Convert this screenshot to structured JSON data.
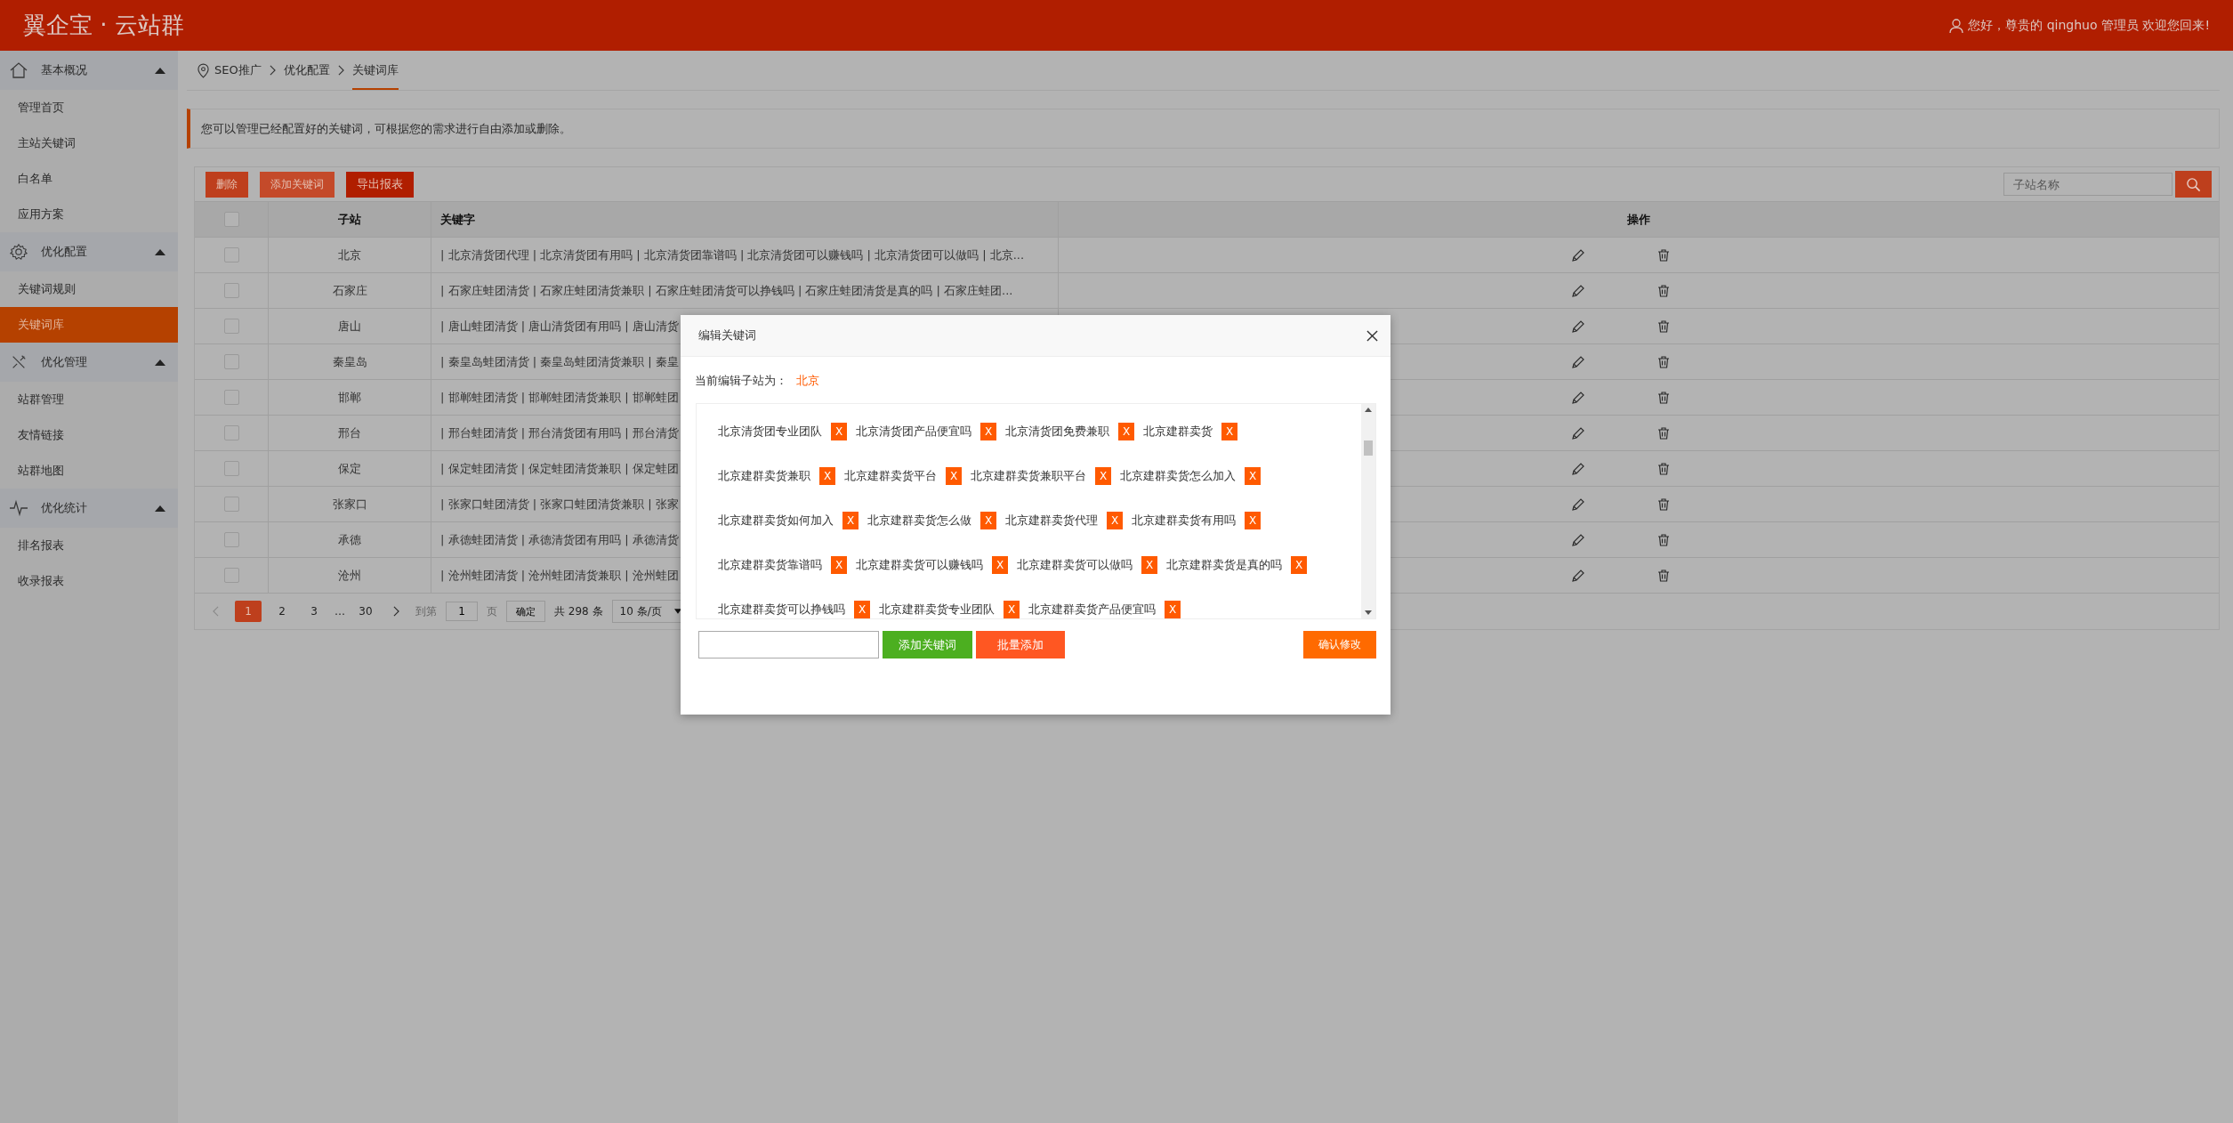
{
  "header": {
    "title": "翼企宝 · 云站群",
    "greeting": "您好，尊贵的 qinghuo 管理员 欢迎您回来!"
  },
  "sidebar": {
    "groups": [
      {
        "label": "基本概况",
        "expanded": true,
        "items": [
          {
            "label": "管理首页",
            "selected": false
          },
          {
            "label": "主站关键词",
            "selected": false
          },
          {
            "label": "白名单",
            "selected": false
          },
          {
            "label": "应用方案",
            "selected": false
          }
        ]
      },
      {
        "label": "优化配置",
        "expanded": true,
        "items": [
          {
            "label": "关键词规则",
            "selected": false
          },
          {
            "label": "关键词库",
            "selected": true
          }
        ]
      },
      {
        "label": "优化管理",
        "expanded": true,
        "items": [
          {
            "label": "站群管理",
            "selected": false
          },
          {
            "label": "友情链接",
            "selected": false
          },
          {
            "label": "站群地图",
            "selected": false
          }
        ]
      },
      {
        "label": "优化统计",
        "expanded": true,
        "items": [
          {
            "label": "排名报表",
            "selected": false
          },
          {
            "label": "收录报表",
            "selected": false
          }
        ]
      }
    ]
  },
  "breadcrumb": [
    {
      "label": "SEO推广",
      "selected": false
    },
    {
      "label": "优化配置",
      "selected": false
    },
    {
      "label": "关键词库",
      "selected": true
    }
  ],
  "notice": "您可以管理已经配置好的关键词，可根据您的需求进行自由添加或删除。",
  "toolbar": {
    "buttons": [
      "删除",
      "添加关键词",
      "导出报表"
    ],
    "search": {
      "placeholder": "子站名称"
    }
  },
  "table": {
    "select_all_checked": false,
    "columns": [
      "子站",
      "关键字",
      "操作"
    ],
    "rows": [
      {
        "checked": false,
        "site": "北京",
        "keywords": "| 北京清货团代理 | 北京清货团有用吗 | 北京清货团靠谱吗 | 北京清货团可以赚钱吗 | 北京清货团可以做吗 | 北京..."
      },
      {
        "checked": false,
        "site": "石家庄",
        "keywords": "| 石家庄蛙团清货 | 石家庄蛙团清货兼职 | 石家庄蛙团清货可以挣钱吗 | 石家庄蛙团清货是真的吗 | 石家庄蛙团..."
      },
      {
        "checked": false,
        "site": "唐山",
        "keywords": "| 唐山蛙团清货 | 唐山清货团有用吗 | 唐山清货"
      },
      {
        "checked": false,
        "site": "秦皇岛",
        "keywords": "| 秦皇岛蛙团清货 | 秦皇岛蛙团清货兼职 | 秦皇"
      },
      {
        "checked": false,
        "site": "邯郸",
        "keywords": "| 邯郸蛙团清货 | 邯郸蛙团清货兼职 | 邯郸蛙团"
      },
      {
        "checked": false,
        "site": "邢台",
        "keywords": "| 邢台蛙团清货 | 邢台清货团有用吗 | 邢台清货"
      },
      {
        "checked": false,
        "site": "保定",
        "keywords": "| 保定蛙团清货 | 保定蛙团清货兼职 | 保定蛙团"
      },
      {
        "checked": false,
        "site": "张家口",
        "keywords": "| 张家口蛙团清货 | 张家口蛙团清货兼职 | 张家"
      },
      {
        "checked": false,
        "site": "承德",
        "keywords": "| 承德蛙团清货 | 承德清货团有用吗 | 承德清货"
      },
      {
        "checked": false,
        "site": "沧州",
        "keywords": "| 沧州蛙团清货 | 沧州蛙团清货兼职 | 沧州蛙团"
      }
    ]
  },
  "pagination": {
    "pages": [
      {
        "label": "1",
        "selected": true
      },
      {
        "label": "2",
        "selected": false
      },
      {
        "label": "3",
        "selected": false
      }
    ],
    "ellipsis": "…",
    "last_pages": [
      {
        "label": "30",
        "selected": false
      }
    ],
    "goto_label": "到第",
    "goto_value": "1",
    "page_unit": "页",
    "confirm": "确定",
    "total": "共 298 条",
    "page_size": "10 条/页"
  },
  "modal": {
    "title": "编辑关键词",
    "current_label": "当前编辑子站为：",
    "current_site": "北京",
    "tag_rows": [
      [
        {
          "text": "北京清货团专业团队",
          "remove": "X"
        },
        {
          "text": "北京清货团产品便宜吗",
          "remove": "X"
        },
        {
          "text": "北京清货团免费兼职",
          "remove": "X"
        },
        {
          "text": "北京建群卖货",
          "remove": "X"
        }
      ],
      [
        {
          "text": "北京建群卖货兼职",
          "remove": "X"
        },
        {
          "text": "北京建群卖货平台",
          "remove": "X"
        },
        {
          "text": "北京建群卖货兼职平台",
          "remove": "X"
        },
        {
          "text": "北京建群卖货怎么加入",
          "remove": "X"
        }
      ],
      [
        {
          "text": "北京建群卖货如何加入",
          "remove": "X"
        },
        {
          "text": "北京建群卖货怎么做",
          "remove": "X"
        },
        {
          "text": "北京建群卖货代理",
          "remove": "X"
        },
        {
          "text": "北京建群卖货有用吗",
          "remove": "X"
        }
      ],
      [
        {
          "text": "北京建群卖货靠谱吗",
          "remove": "X"
        },
        {
          "text": "北京建群卖货可以赚钱吗",
          "remove": "X"
        },
        {
          "text": "北京建群卖货可以做吗",
          "remove": "X"
        },
        {
          "text": "北京建群卖货是真的吗",
          "remove": "X"
        }
      ],
      [
        {
          "text": "北京建群卖货可以挣钱吗",
          "remove": "X"
        },
        {
          "text": "北京建群卖货专业团队",
          "remove": "X"
        },
        {
          "text": "北京建群卖货产品便宜吗",
          "remove": "X"
        }
      ]
    ],
    "add_button": "添加关键词",
    "batch_button": "批量添加",
    "confirm_button": "确认修改"
  }
}
